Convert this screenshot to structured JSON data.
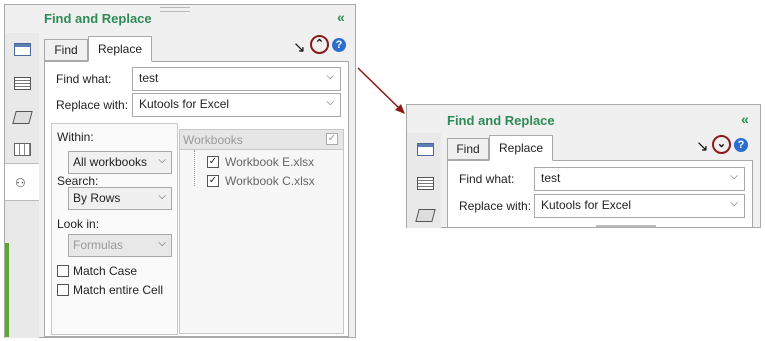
{
  "colors": {
    "title_green": "#2e8b57",
    "accent_circle": "#8b1a1a",
    "help_blue": "#2a6fd0",
    "arrow_red": "#8b1a1a"
  },
  "expanded": {
    "title": "Find and Replace",
    "collapse_label": "«",
    "tabs": [
      "Find",
      "Replace"
    ],
    "active_tab": "Replace",
    "find_what_label": "Find what:",
    "find_what_value": "test",
    "replace_with_label": "Replace with:",
    "replace_with_value": "Kutools for Excel",
    "within_label": "Within:",
    "within_value": "All workbooks",
    "search_label": "Search:",
    "search_value": "By Rows",
    "look_in_label": "Look in:",
    "look_in_value": "Formulas",
    "match_case_label": "Match Case",
    "match_entire_cell_label": "Match entire Cell",
    "workbooks_header": "Workbooks",
    "workbooks": [
      "Workbook E.xlsx",
      "Workbook C.xlsx"
    ],
    "toggle_icon": "double-chevron-up-icon",
    "help_icon": "help-icon"
  },
  "collapsed": {
    "title": "Find and Replace",
    "collapse_label": "«",
    "tabs": [
      "Find",
      "Replace"
    ],
    "active_tab": "Replace",
    "find_what_label": "Find what:",
    "find_what_value": "test",
    "replace_with_label": "Replace with:",
    "replace_with_value": "Kutools for Excel",
    "toggle_icon": "double-chevron-down-icon",
    "help_icon": "help-icon"
  },
  "sidebar_icons": [
    "worksheet-icon",
    "list-icon",
    "layers-icon",
    "grid-icon",
    "binoculars-icon"
  ]
}
